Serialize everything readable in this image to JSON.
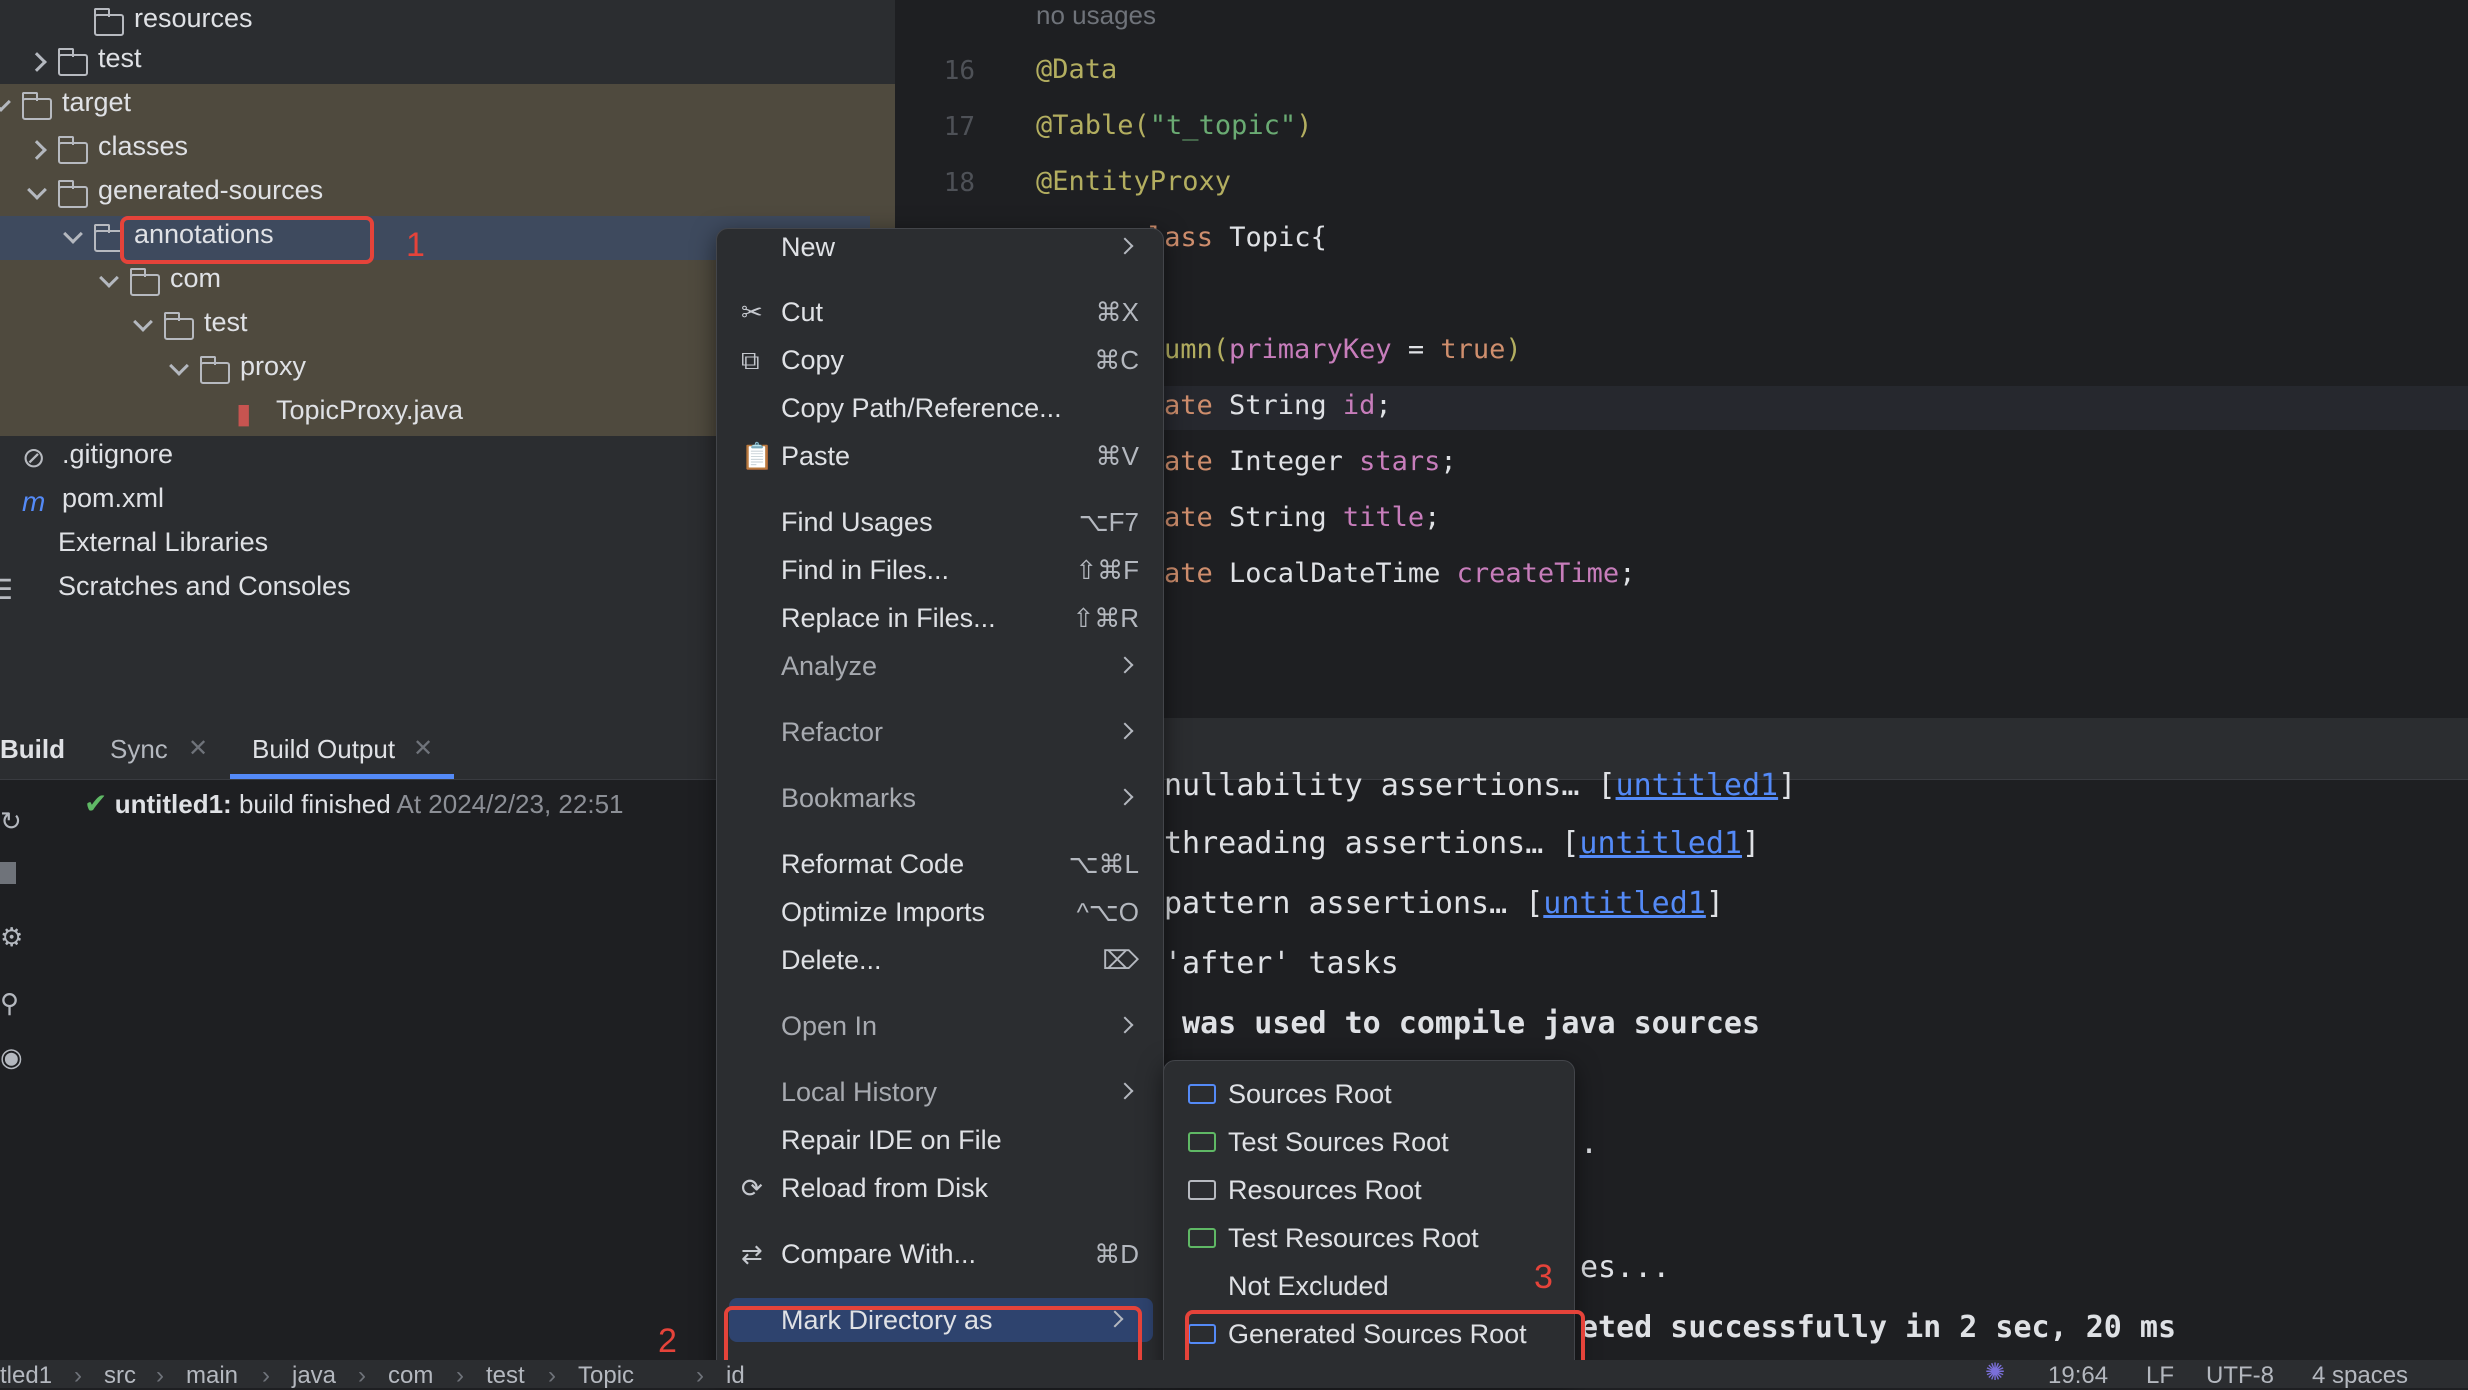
{
  "project_tree": {
    "items": [
      {
        "label": "resources",
        "kind": "resources-folder"
      },
      {
        "label": "test",
        "kind": "folder"
      },
      {
        "label": "target",
        "kind": "folder"
      },
      {
        "label": "classes",
        "kind": "folder"
      },
      {
        "label": "generated-sources",
        "kind": "folder"
      },
      {
        "label": "annotations",
        "kind": "folder"
      },
      {
        "label": "com",
        "kind": "folder"
      },
      {
        "label": "test",
        "kind": "folder"
      },
      {
        "label": "proxy",
        "kind": "folder"
      },
      {
        "label": "TopicProxy.java",
        "kind": "java-file"
      },
      {
        "label": ".gitignore",
        "kind": "ignore-file"
      },
      {
        "label": "pom.xml",
        "kind": "maven-file"
      },
      {
        "label": "External Libraries",
        "kind": "library"
      },
      {
        "label": "Scratches and Consoles",
        "kind": "scratches"
      }
    ]
  },
  "editor": {
    "usage_hint": "no usages",
    "line_numbers": [
      "16",
      "17",
      "18"
    ],
    "lines": {
      "l16": "@Data",
      "l17_ann": "@Table(",
      "l17_str": "\"t_topic\"",
      "l17_end": ")",
      "l18": "@EntityProxy",
      "l19_kw": "lass",
      "l19_rest": " Topic{",
      "l21_a": "umn(",
      "l21_b": "primaryKey",
      "l21_c": " = ",
      "l21_d": "true",
      "l21_e": ")",
      "l22_kw": "ate",
      "l22_type": " String ",
      "l22_field": "id",
      "l23_kw": "ate",
      "l23_type": " Integer ",
      "l23_field": "stars",
      "l24_kw": "ate",
      "l24_type": " String ",
      "l24_field": "title",
      "l25_kw": "ate",
      "l25_type": " LocalDateTime ",
      "l25_field": "createTime"
    }
  },
  "build_panel": {
    "tabs": [
      "Build",
      "Sync",
      "Build Output"
    ],
    "result_project": "untitled1:",
    "result_text": "build finished",
    "result_time": "At 2024/2/23, 22:51",
    "console_lines": [
      {
        "pre": "nullability assertions… [",
        "link": "untitled1",
        "post": "]"
      },
      {
        "pre": "threading assertions… [",
        "link": "untitled1",
        "post": "]"
      },
      {
        "pre": "pattern assertions… [",
        "link": "untitled1",
        "post": "]"
      },
      {
        "pre": "'after' tasks",
        "link": "",
        "post": ""
      },
      {
        "pre": " was used to compile java sources",
        "link": "",
        "post": ""
      },
      {
        "pre": ".",
        "link": "",
        "post": ""
      },
      {
        "pre": "es...",
        "link": "",
        "post": ""
      },
      {
        "pre": "eted successfully in 2 sec, 20 ms",
        "link": "",
        "post": ""
      }
    ]
  },
  "context_menu": {
    "items": [
      {
        "label": "New",
        "shortcut": "",
        "submenu": true,
        "dim": false,
        "icon": ""
      },
      {
        "label": "Cut",
        "shortcut": "⌘X",
        "submenu": false,
        "dim": false,
        "icon": "✂"
      },
      {
        "label": "Copy",
        "shortcut": "⌘C",
        "submenu": false,
        "dim": false,
        "icon": "⧉"
      },
      {
        "label": "Copy Path/Reference...",
        "shortcut": "",
        "submenu": false,
        "dim": false,
        "icon": ""
      },
      {
        "label": "Paste",
        "shortcut": "⌘V",
        "submenu": false,
        "dim": false,
        "icon": "📋"
      },
      {
        "label": "Find Usages",
        "shortcut": "⌥F7",
        "submenu": false,
        "dim": false,
        "icon": ""
      },
      {
        "label": "Find in Files...",
        "shortcut": "⇧⌘F",
        "submenu": false,
        "dim": false,
        "icon": ""
      },
      {
        "label": "Replace in Files...",
        "shortcut": "⇧⌘R",
        "submenu": false,
        "dim": false,
        "icon": ""
      },
      {
        "label": "Analyze",
        "shortcut": "",
        "submenu": true,
        "dim": true,
        "icon": ""
      },
      {
        "label": "Refactor",
        "shortcut": "",
        "submenu": true,
        "dim": true,
        "icon": ""
      },
      {
        "label": "Bookmarks",
        "shortcut": "",
        "submenu": true,
        "dim": true,
        "icon": ""
      },
      {
        "label": "Reformat Code",
        "shortcut": "⌥⌘L",
        "submenu": false,
        "dim": false,
        "icon": ""
      },
      {
        "label": "Optimize Imports",
        "shortcut": "^⌥O",
        "submenu": false,
        "dim": false,
        "icon": ""
      },
      {
        "label": "Delete...",
        "shortcut": "⌦",
        "submenu": false,
        "dim": false,
        "icon": ""
      },
      {
        "label": "Open In",
        "shortcut": "",
        "submenu": true,
        "dim": true,
        "icon": ""
      },
      {
        "label": "Local History",
        "shortcut": "",
        "submenu": true,
        "dim": true,
        "icon": ""
      },
      {
        "label": "Repair IDE on File",
        "shortcut": "",
        "submenu": false,
        "dim": false,
        "icon": ""
      },
      {
        "label": "Reload from Disk",
        "shortcut": "",
        "submenu": false,
        "dim": false,
        "icon": "⟳"
      },
      {
        "label": "Compare With...",
        "shortcut": "⌘D",
        "submenu": false,
        "dim": false,
        "icon": "⇄"
      },
      {
        "label": "Mark Directory as",
        "shortcut": "",
        "submenu": true,
        "dim": false,
        "icon": ""
      }
    ]
  },
  "mark_directory_submenu": {
    "items": [
      {
        "label": "Sources Root",
        "color": "#548af7"
      },
      {
        "label": "Test Sources Root",
        "color": "#5fb865"
      },
      {
        "label": "Resources Root",
        "color": "#b7bac0"
      },
      {
        "label": "Test Resources Root",
        "color": "#5fb865"
      },
      {
        "label": "Not Excluded",
        "color": ""
      },
      {
        "label": "Generated Sources Root",
        "color": "#548af7"
      }
    ]
  },
  "annotations": {
    "step1": "1",
    "step2": "2",
    "step3": "3"
  },
  "breadcrumb": [
    "tled1",
    "src",
    "main",
    "java",
    "com",
    "test",
    "Topic",
    "id"
  ],
  "status": {
    "position": "19:64",
    "line_sep": "LF",
    "encoding": "UTF-8",
    "indent": "4 spaces"
  },
  "colors": {
    "accent": "#548af7",
    "highlight_box": "#e5433a",
    "success": "#5fb865"
  }
}
